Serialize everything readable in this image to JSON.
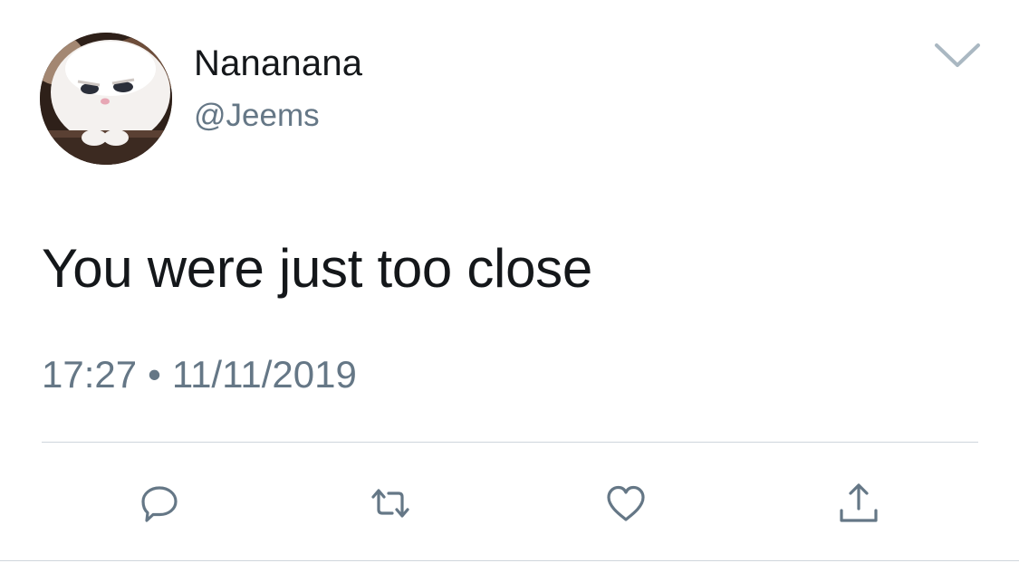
{
  "user": {
    "display_name": "Nananana",
    "handle": "@Jeems"
  },
  "tweet": {
    "text": "You were just too close",
    "time": "17:27",
    "separator": "•",
    "date": "11/11/2019"
  },
  "icons": {
    "menu": "chevron-down-icon",
    "reply": "speech-bubble-icon",
    "retweet": "retweet-arrows-icon",
    "like": "heart-icon",
    "share": "share-upload-icon"
  },
  "colors": {
    "text_primary": "#14171a",
    "text_secondary": "#657786",
    "icon": "#657786",
    "divider": "#cfd6dc"
  }
}
